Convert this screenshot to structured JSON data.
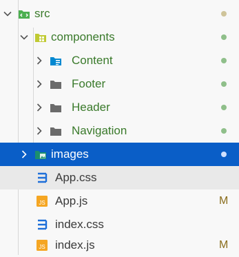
{
  "explorer": {
    "items": [
      {
        "label": "src",
        "status": "",
        "dot_color": "#cfc49a"
      },
      {
        "label": "components",
        "status": "",
        "dot_color": "#8fbf8a"
      },
      {
        "label": "Content",
        "status": "",
        "dot_color": "#8fbf8a"
      },
      {
        "label": "Footer",
        "status": "",
        "dot_color": "#8fbf8a"
      },
      {
        "label": "Header",
        "status": "",
        "dot_color": "#8fbf8a"
      },
      {
        "label": "Navigation",
        "status": "",
        "dot_color": "#8fbf8a"
      },
      {
        "label": "images",
        "status": "",
        "dot_color": "#cfe0ff"
      },
      {
        "label": "App.css",
        "status": ""
      },
      {
        "label": "App.js",
        "status": "M"
      },
      {
        "label": "index.css",
        "status": ""
      },
      {
        "label": "index.js",
        "status": "M"
      }
    ]
  },
  "colors": {
    "selected_bg": "#0a5ec7",
    "folder_label": "#3a7a2b",
    "file_label": "#3a3a3a",
    "modified": "#8a6d1c"
  }
}
